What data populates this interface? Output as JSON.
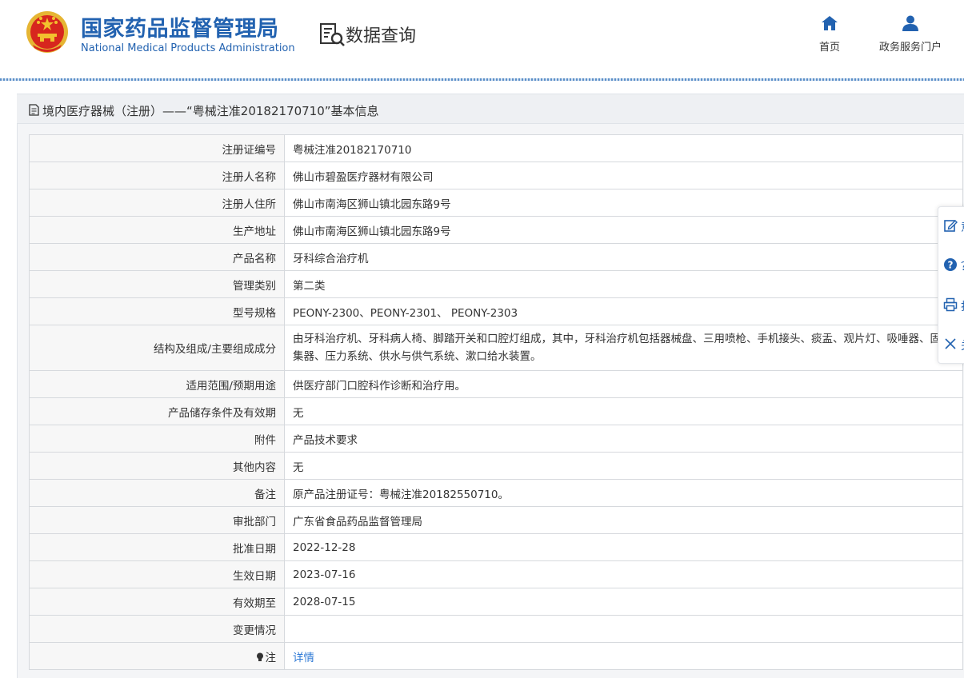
{
  "header": {
    "brand_cn": "国家药品监督管理局",
    "brand_en": "National Medical Products Administration",
    "query_title": "数据查询",
    "nav": {
      "home": "首页",
      "portal": "政务服务门户"
    }
  },
  "section": {
    "title": "境内医疗器械（注册）——“粤械注准20182170710”基本信息"
  },
  "records": [
    {
      "label": "注册证编号",
      "value": "粤械注准20182170710"
    },
    {
      "label": "注册人名称",
      "value": "佛山市碧盈医疗器材有限公司"
    },
    {
      "label": "注册人住所",
      "value": "佛山市南海区狮山镇北园东路9号"
    },
    {
      "label": "生产地址",
      "value": "佛山市南海区狮山镇北园东路9号"
    },
    {
      "label": "产品名称",
      "value": "牙科综合治疗机"
    },
    {
      "label": "管理类别",
      "value": "第二类"
    },
    {
      "label": "型号规格",
      "value": "PEONY-2300、PEONY-2301、 PEONY-2303"
    },
    {
      "label": "结构及组成/主要组成成分",
      "value": "由牙科治疗机、牙科病人椅、脚踏开关和口腔灯组成，其中，牙科治疗机包括器械盘、三用喷枪、手机接头、痰盂、观片灯、吸唾器、固体收集器、压力系统、供水与供气系统、漱口给水装置。"
    },
    {
      "label": "适用范围/预期用途",
      "value": "供医疗部门口腔科作诊断和治疗用。"
    },
    {
      "label": "产品储存条件及有效期",
      "value": "无"
    },
    {
      "label": "附件",
      "value": "产品技术要求"
    },
    {
      "label": "其他内容",
      "value": "无"
    },
    {
      "label": "备注",
      "value": "原产品注册证号：粤械注准20182550710。"
    },
    {
      "label": "审批部门",
      "value": "广东省食品药品监督管理局"
    },
    {
      "label": "批准日期",
      "value": "2022-12-28"
    },
    {
      "label": "生效日期",
      "value": "2023-07-16"
    },
    {
      "label": "有效期至",
      "value": "2028-07-15"
    },
    {
      "label": "变更情况",
      "value": ""
    }
  ],
  "note_row": {
    "label": "注",
    "link": "详情"
  },
  "float_bar": [
    {
      "label": "意"
    },
    {
      "label": "？"
    },
    {
      "label": "打"
    },
    {
      "label": "关"
    }
  ],
  "colors": {
    "brand_blue": "#2262b0",
    "link_blue": "#2f7ad6",
    "emblem_red": "#d7261e",
    "emblem_gold": "#f2c12e"
  }
}
